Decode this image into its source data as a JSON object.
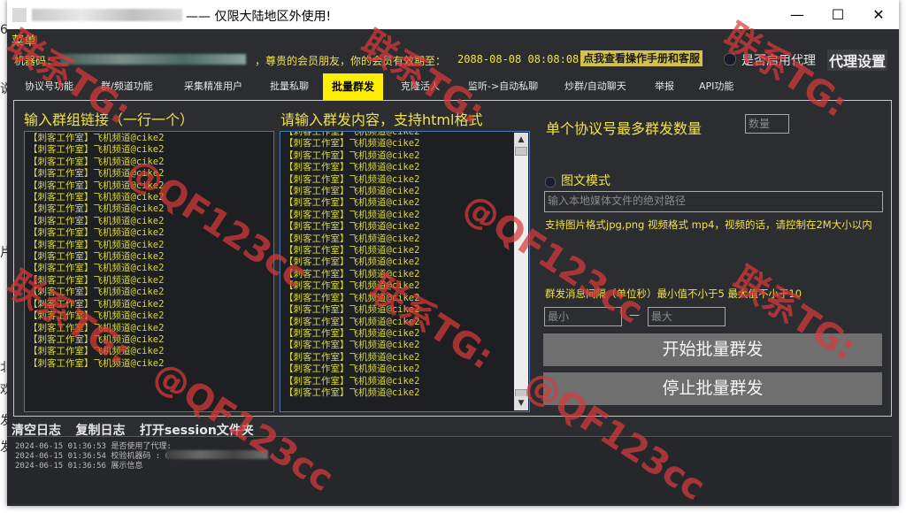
{
  "window": {
    "title": "—— 仅限大陆地区外使用!",
    "controls": {
      "minimize": "—",
      "maximize": "☐",
      "close": "✕"
    }
  },
  "menu": {
    "label": "菜单"
  },
  "info": {
    "machine_label": "机器码:",
    "vip_text": "，尊贵的会员朋友，你的会员有效期至：",
    "vip_date": "2088-08-08 08:08:08",
    "manual_button": "点我查看操作手册和客服",
    "proxy_label": "是否启用代理",
    "proxy_settings_button": "代理设置"
  },
  "tabs": [
    {
      "label": "协议号功能"
    },
    {
      "label": "群/频道功能"
    },
    {
      "label": "采集精准用户"
    },
    {
      "label": "批量私聊"
    },
    {
      "label": "批量群发"
    },
    {
      "label": "克隆活人"
    },
    {
      "label": "监听->自动私聊"
    },
    {
      "label": "炒群/自动聊天"
    },
    {
      "label": "举报"
    },
    {
      "label": "API功能"
    }
  ],
  "left_column": {
    "heading": "输入群组链接（一行一个）",
    "line_text": "【刺客工作室】飞机频道@cike2",
    "line_count": 20
  },
  "middle_column": {
    "heading": "请输入群发内容，支持html格式",
    "line_text": "【刺客工作室】飞机频道@cike2",
    "line_count": 23
  },
  "right_column": {
    "max_per_account_label": "单个协议号最多群发数量",
    "max_per_account_placeholder": "数量",
    "media_mode_label": "图文模式",
    "media_path_placeholder": "输入本地媒体文件的绝对路径",
    "media_hint": "支持图片格式jpg,png 视频格式 mp4，视频的话，请控制在2M大小以内",
    "interval_label": "群发消息间隔（单位秒）最小值不小于5 最大值不小于10",
    "min_placeholder": "最小",
    "interval_dash": "—",
    "max_placeholder": "最大",
    "start_button": "开始批量群发",
    "stop_button": "停止批量群发"
  },
  "bottom_actions": {
    "clear_log": "清空日志",
    "copy_log": "复制日志",
    "open_session_folder": "打开session文件夹"
  },
  "log": [
    "2024-06-15 01:36:53 是否使用了代理:",
    "2024-06-15 01:36:54 校验机器码 : 6",
    "2024-06-15 01:36:56 展示信息"
  ],
  "watermarks": [
    "联系TG:",
    "@QF123cc"
  ]
}
